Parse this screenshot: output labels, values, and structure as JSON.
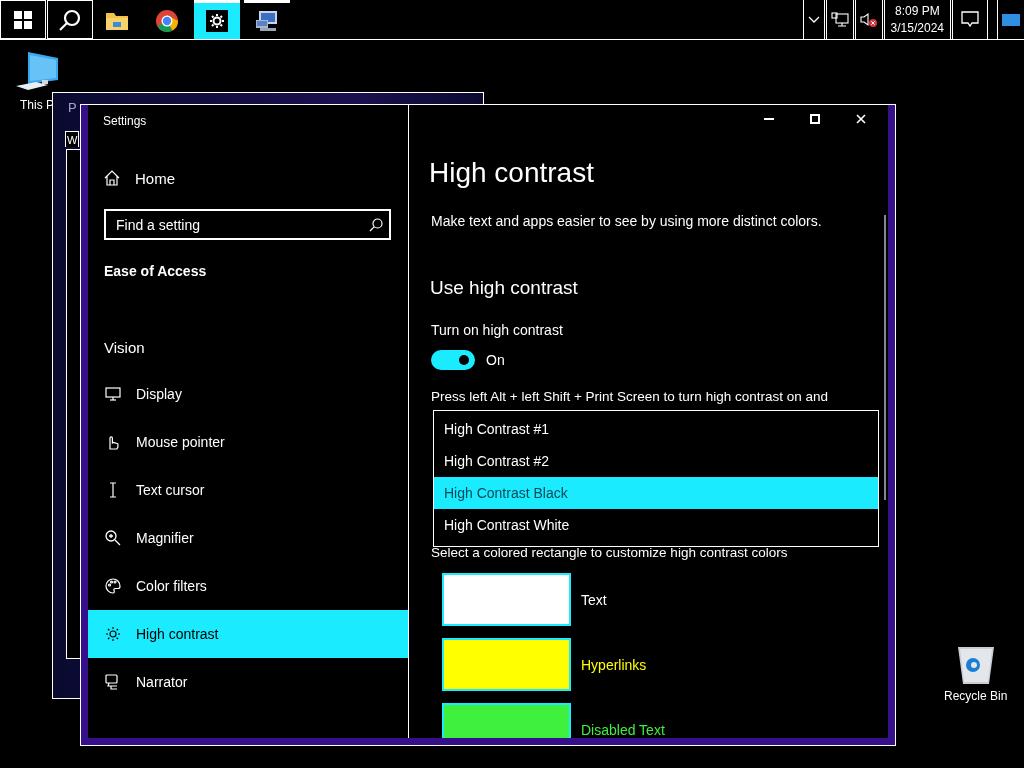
{
  "taskbar": {
    "apps": [
      {
        "kind": "start",
        "selected": false,
        "running": false
      },
      {
        "kind": "search",
        "selected": false,
        "running": false
      },
      {
        "kind": "folder",
        "selected": false,
        "running": false
      },
      {
        "kind": "browser",
        "selected": false,
        "running": false
      },
      {
        "kind": "settings",
        "selected": true,
        "running": true
      },
      {
        "kind": "remote",
        "selected": false,
        "running": true
      }
    ],
    "time": "8:09 PM",
    "date": "3/15/2024"
  },
  "desktop_icons": [
    {
      "kind": "computer",
      "label": "This P"
    },
    {
      "kind": "recycle_bin",
      "label": "Recycle Bin"
    }
  ],
  "back_window": {
    "title": "P",
    "tab": "W"
  },
  "settings": {
    "title": "Settings",
    "nav": {
      "home": "Home",
      "search_placeholder": "Find a setting",
      "section": "Ease of Access",
      "group": "Vision",
      "items": [
        {
          "kind": "display",
          "label": "Display",
          "selected": false
        },
        {
          "kind": "mouse",
          "label": "Mouse pointer",
          "selected": false
        },
        {
          "kind": "cursor",
          "label": "Text cursor",
          "selected": false
        },
        {
          "kind": "magnifier",
          "label": "Magnifier",
          "selected": false
        },
        {
          "kind": "palette",
          "label": "Color filters",
          "selected": false
        },
        {
          "kind": "sun",
          "label": "High contrast",
          "selected": true
        },
        {
          "kind": "narrator",
          "label": "Narrator",
          "selected": false
        }
      ]
    },
    "page": {
      "heading": "High contrast",
      "description": "Make text and apps easier to see by using more distinct colors.",
      "subheading": "Use high contrast",
      "toggle": {
        "label": "Turn on high contrast",
        "on": true,
        "state_text": "On"
      },
      "shortcut_text": "Press left Alt + left Shift + Print Screen to turn high contrast on and",
      "theme_options": [
        {
          "label": "High Contrast #1",
          "selected": false
        },
        {
          "label": "High Contrast #2",
          "selected": false
        },
        {
          "label": "High Contrast Black",
          "selected": true
        },
        {
          "label": "High Contrast White",
          "selected": false
        }
      ],
      "colors_hint": "Select a colored rectangle to customize high contrast colors",
      "colors": [
        {
          "label": "Text",
          "color": "#ffffff"
        },
        {
          "label": "Hyperlinks",
          "color": "#ffff00"
        },
        {
          "label": "Disabled Text",
          "color": "#3ff03f"
        }
      ]
    }
  }
}
